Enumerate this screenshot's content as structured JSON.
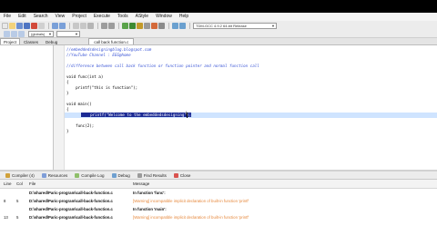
{
  "menu": [
    "File",
    "Edit",
    "Search",
    "View",
    "Project",
    "Execute",
    "Tools",
    "AStyle",
    "Window",
    "Help"
  ],
  "toolbar": {
    "compiler_select": "TDM-GCC 4.9.2 64-bit Release",
    "globals_select": "(globals)"
  },
  "panel_tabs": [
    "Project",
    "Classes",
    "Debug"
  ],
  "editor": {
    "tab_label": "call back function.c",
    "lines": [
      {
        "n": "1",
        "text": "//embeddedsdesigningblog.blogspot.com",
        "cls": "c-comment"
      },
      {
        "n": "2",
        "text": "//YouTube Channel : EEG@home",
        "cls": "c-comment"
      },
      {
        "n": "3",
        "text": "",
        "cls": ""
      },
      {
        "n": "4",
        "text": "//difference between call back function or function pointer and normal function call",
        "cls": "c-comment"
      },
      {
        "n": "5",
        "text": "",
        "cls": ""
      },
      {
        "n": "6",
        "text": "void func(int a)",
        "cls": ""
      },
      {
        "n": "7",
        "text": "{",
        "cls": ""
      },
      {
        "n": "8",
        "text": "    printf(\"this is function\");",
        "cls": ""
      },
      {
        "n": "9",
        "text": "}",
        "cls": ""
      },
      {
        "n": "10",
        "text": "",
        "cls": ""
      },
      {
        "n": "11",
        "text": "void main()",
        "cls": ""
      },
      {
        "n": "12",
        "text": "{",
        "cls": ""
      },
      {
        "n": "13",
        "text": "    printf(\"Welcome to the embeddedsdesigning\");",
        "cls": "sel-line"
      },
      {
        "n": "14",
        "text": "",
        "cls": ""
      },
      {
        "n": "15",
        "text": "    func(2);",
        "cls": ""
      },
      {
        "n": "16",
        "text": "}",
        "cls": ""
      }
    ]
  },
  "bottom_tabs": [
    "Compiler (4)",
    "Resources",
    "Compile Log",
    "Debug",
    "Find Results",
    "Close"
  ],
  "compiler_table": {
    "headers": {
      "line": "Line",
      "col": "Col",
      "file": "File",
      "message": "Message"
    },
    "rows": [
      {
        "line": "",
        "col": "",
        "file": "D:\\shared\\Paric-program\\call-back-function.c",
        "message": "In function 'func':",
        "style": "bold"
      },
      {
        "line": "8",
        "col": "5",
        "file": "D:\\shared\\Paric-program\\call-back-function.c",
        "message": "[Warning] incompatible implicit declaration of built-in function 'printf'",
        "style": "warn"
      },
      {
        "line": "",
        "col": "",
        "file": "D:\\shared\\Paric-program\\call-back-function.c",
        "message": "In function 'main':",
        "style": "bold"
      },
      {
        "line": "13",
        "col": "5",
        "file": "D:\\shared\\Paric-program\\call-back-function.c",
        "message": "[Warning] incompatible implicit declaration of built-in function 'printf'",
        "style": "warn"
      }
    ]
  },
  "colors": {
    "selection": "#1b2a94",
    "comment": "#3a55d6",
    "warning": "#e6873a",
    "current_line": "#cfe4ff"
  }
}
